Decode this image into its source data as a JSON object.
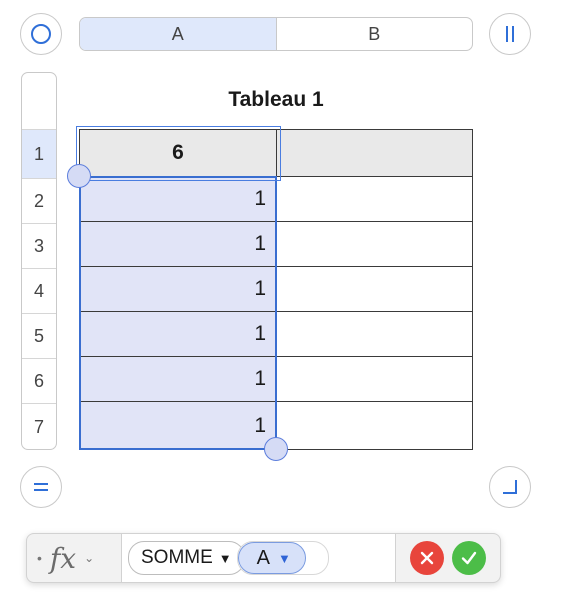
{
  "columns": [
    "A",
    "B"
  ],
  "rows": [
    "1",
    "2",
    "3",
    "4",
    "5",
    "6",
    "7"
  ],
  "table": {
    "title": "Tableau 1",
    "header": [
      "6",
      ""
    ],
    "body": [
      [
        "1",
        ""
      ],
      [
        "1",
        ""
      ],
      [
        "1",
        ""
      ],
      [
        "1",
        ""
      ],
      [
        "1",
        ""
      ],
      [
        "1",
        ""
      ]
    ]
  },
  "formula": {
    "fx_label": "fx",
    "function": "SOMME",
    "argument": "A"
  },
  "colors": {
    "selection": "#3a6ed0",
    "selection_fill": "#e1e4f7",
    "cancel": "#e8453c",
    "accept": "#4cbd48"
  },
  "icons": [
    "circle-icon",
    "pause-icon",
    "equal-icon",
    "corner-icon",
    "cancel-icon",
    "accept-icon"
  ]
}
